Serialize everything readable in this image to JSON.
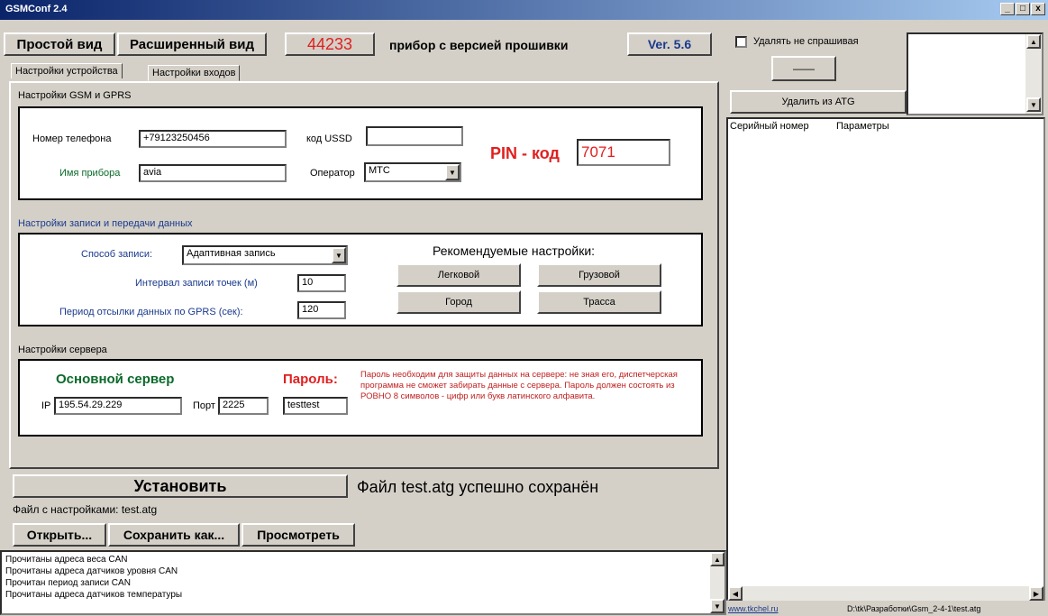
{
  "window": {
    "title": "GSMConf 2.4"
  },
  "header": {
    "simple_view": "Простой вид",
    "extended_view": "Расширенный вид",
    "device_number": "44233",
    "firmware_label": "прибор с версией прошивки",
    "version": "Ver. 5.6"
  },
  "tabs": [
    "Настройки устройства",
    "Настройки входов"
  ],
  "gsm": {
    "section_title": "Настройки GSM и GPRS",
    "phone_label": "Номер телефона",
    "phone_value": "+79123250456",
    "ussd_label": "код USSD",
    "ussd_value": "",
    "name_label": "Имя прибора",
    "name_value": "avia",
    "operator_label": "Оператор",
    "operator_value": "МТС",
    "pin_label": "PIN - код",
    "pin_value": "7071"
  },
  "record": {
    "section_title": "Настройки записи и передачи данных",
    "method_label": "Способ записи:",
    "method_value": "Адаптивная запись",
    "interval_label": "Интервал записи точек (м)",
    "interval_value": "10",
    "period_label": "Период отсылки данных по GPRS (сек):",
    "period_value": "120",
    "recommended_label": "Рекомендуемые настройки:",
    "btn_car": "Легковой",
    "btn_truck": "Грузовой",
    "btn_city": "Город",
    "btn_highway": "Трасса"
  },
  "server": {
    "section_title": "Настройки сервера",
    "main_label": "Основной сервер",
    "ip_label": "IP",
    "ip_value": "195.54.29.229",
    "port_label": "Порт",
    "port_value": "2225",
    "password_label": "Пароль:",
    "password_value": "testtest",
    "note": "Пароль необходим для защиты данных на сервере: не зная его, диспетчерская программа не сможет забирать данные с сервера. Пароль должен состоять из РОВНО 8 символов - цифр или букв латинского алфавита."
  },
  "actions": {
    "install": "Установить",
    "status": "Файл test.atg успешно сохранён",
    "file_info": "Файл с настройками: test.atg",
    "open": "Открыть...",
    "save_as": "Сохранить как...",
    "view": "Просмотреть"
  },
  "log": [
    "Прочитаны адреса веса CAN",
    "Прочитаны адреса датчиков уровня CAN",
    "Прочитан период записи CAN",
    "Прочитаны адреса датчиков температуры"
  ],
  "right": {
    "delete_no_ask": "Удалять не спрашивая",
    "dash_button": "——",
    "delete_from_atg": "Удалить из ATG",
    "col_serial": "Серийный номер",
    "col_params": "Параметры",
    "footer_link": "www.tkchel.ru",
    "footer_path": "D:\\tk\\Разработки\\Gsm_2-4-1\\test.atg"
  }
}
